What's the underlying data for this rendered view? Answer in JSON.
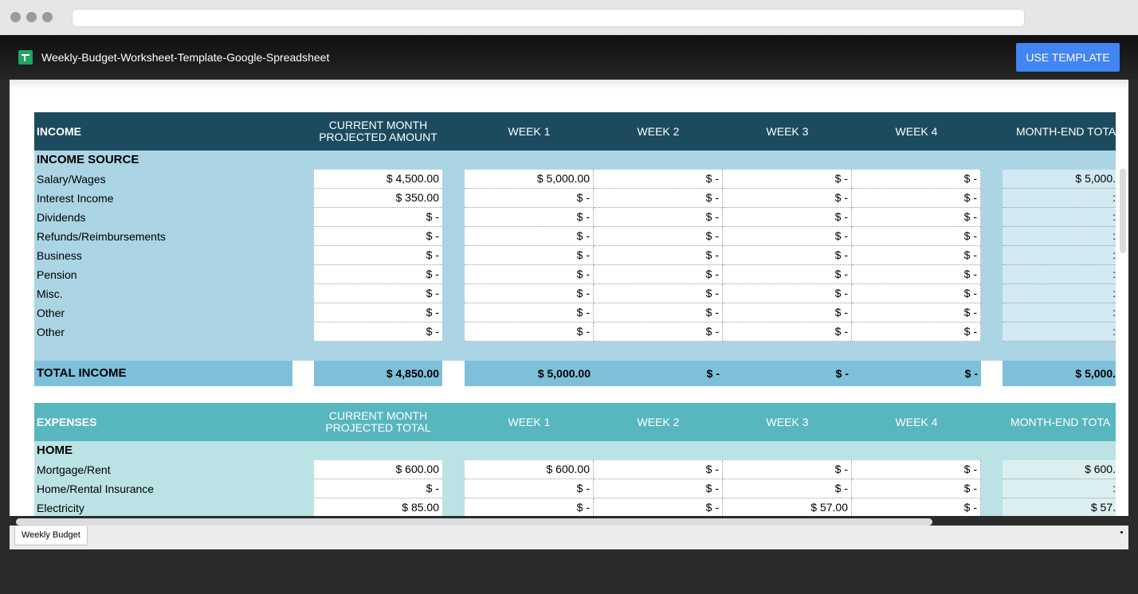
{
  "browser": {
    "url": ""
  },
  "app": {
    "title": "Weekly-Budget-Worksheet-Template-Google-Spreadsheet",
    "use_template_label": "USE TEMPLATE",
    "icon": "google-sheets-icon"
  },
  "colors": {
    "income_header": "#1c4b5f",
    "income_band": "#abd5e5",
    "income_total": "#7ec0d9",
    "income_month_end_cell": "#d2e9f1",
    "expenses_header": "#58b6bf",
    "expenses_band": "#bbe2e4",
    "expenses_month_end_cell": "#dbeff1",
    "button": "#4285f4"
  },
  "income": {
    "header": {
      "label": "INCOME",
      "projected_line1": "CURRENT MONTH",
      "projected_line2": "PROJECTED AMOUNT",
      "week1": "WEEK 1",
      "week2": "WEEK 2",
      "week3": "WEEK 3",
      "week4": "WEEK 4",
      "month_end": "MONTH-END TOTAL"
    },
    "subheader": "INCOME SOURCE",
    "rows": [
      {
        "label": "Salary/Wages",
        "projected": "$ 4,500.00",
        "week1": "$ 5,000.00",
        "week2": "$ -",
        "week3": "$ -",
        "week4": "$ -",
        "month_end": "$ 5,000."
      },
      {
        "label": "Interest Income",
        "projected": "$ 350.00",
        "week1": "$ -",
        "week2": "$ -",
        "week3": "$ -",
        "week4": "$ -",
        "month_end": ":"
      },
      {
        "label": "Dividends",
        "projected": "$ -",
        "week1": "$ -",
        "week2": "$ -",
        "week3": "$ -",
        "week4": "$ -",
        "month_end": ":"
      },
      {
        "label": "Refunds/Reimbursements",
        "projected": "$ -",
        "week1": "$ -",
        "week2": "$ -",
        "week3": "$ -",
        "week4": "$ -",
        "month_end": ":"
      },
      {
        "label": "Business",
        "projected": "$ -",
        "week1": "$ -",
        "week2": "$ -",
        "week3": "$ -",
        "week4": "$ -",
        "month_end": ":"
      },
      {
        "label": "Pension",
        "projected": "$ -",
        "week1": "$ -",
        "week2": "$ -",
        "week3": "$ -",
        "week4": "$ -",
        "month_end": ":"
      },
      {
        "label": "Misc.",
        "projected": "$ -",
        "week1": "$ -",
        "week2": "$ -",
        "week3": "$ -",
        "week4": "$ -",
        "month_end": ":"
      },
      {
        "label": "Other",
        "projected": "$ -",
        "week1": "$ -",
        "week2": "$ -",
        "week3": "$ -",
        "week4": "$ -",
        "month_end": ":"
      },
      {
        "label": "Other",
        "projected": "$ -",
        "week1": "$ -",
        "week2": "$ -",
        "week3": "$ -",
        "week4": "$ -",
        "month_end": ":"
      }
    ],
    "total": {
      "label": "TOTAL INCOME",
      "projected": "$ 4,850.00",
      "week1": "$ 5,000.00",
      "week2": "$ -",
      "week3": "$ -",
      "week4": "$ -",
      "month_end": "$ 5,000."
    }
  },
  "expenses": {
    "header": {
      "label": "EXPENSES",
      "projected_line1": "CURRENT MONTH",
      "projected_line2": "PROJECTED TOTAL",
      "week1": "WEEK 1",
      "week2": "WEEK 2",
      "week3": "WEEK 3",
      "week4": "WEEK 4",
      "month_end": "MONTH-END TOTA"
    },
    "subheader": "HOME",
    "rows": [
      {
        "label": "Mortgage/Rent",
        "projected": "$ 600.00",
        "week1": "$ 600.00",
        "week2": "$ -",
        "week3": "$ -",
        "week4": "$ -",
        "month_end": "$ 600."
      },
      {
        "label": "Home/Rental Insurance",
        "projected": "$ -",
        "week1": "$ -",
        "week2": "$ -",
        "week3": "$ -",
        "week4": "$ -",
        "month_end": ":"
      },
      {
        "label": "Electricity",
        "projected": "$ 85.00",
        "week1": "$ -",
        "week2": "$ -",
        "week3": "$ 57.00",
        "week4": "$ -",
        "month_end": "$ 57."
      }
    ]
  },
  "sheet_tabs": [
    {
      "label": "Weekly Budget",
      "active": true
    }
  ]
}
